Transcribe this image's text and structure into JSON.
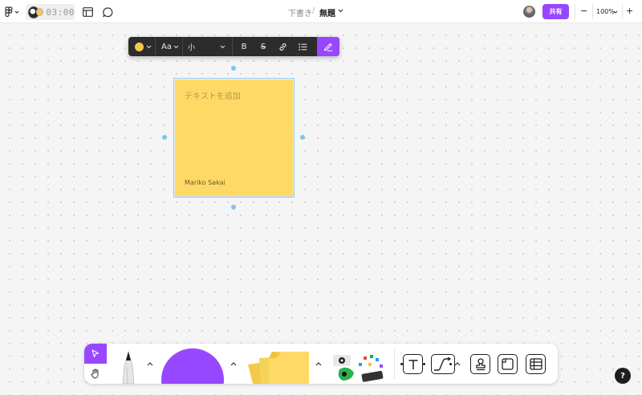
{
  "topbar": {
    "timer": "03:00",
    "breadcrumb_folder": "下書き",
    "breadcrumb_separator": "/",
    "file_name": "無題",
    "share_label": "共有",
    "zoom_level": "100%",
    "zoom_out_symbol": "−",
    "zoom_in_symbol": "+"
  },
  "format_toolbar": {
    "font_size_icon_label": "Aa",
    "size_value": "小",
    "bold_label": "B",
    "strike_label": "S",
    "color_swatch": "#f2c94c"
  },
  "sticky": {
    "placeholder": "テキストを追加",
    "author": "Mariko Sakai",
    "color": "#ffd966"
  },
  "colors": {
    "accent": "#9747ff",
    "handle": "#7cc4f0",
    "toolbar_dark": "#2c2c2c"
  },
  "help_label": "?",
  "icons": [
    "figma-menu-icon",
    "layout-icon",
    "comment-icon",
    "chevron-down-icon",
    "link-icon",
    "list-icon",
    "marker-icon",
    "select-arrow-icon",
    "hand-icon",
    "pen-tool-icon",
    "shape-tool-icon",
    "sticky-tool-icon",
    "widgets-icon",
    "text-tool-icon",
    "connector-icon",
    "stamp-icon",
    "section-icon",
    "table-icon"
  ]
}
